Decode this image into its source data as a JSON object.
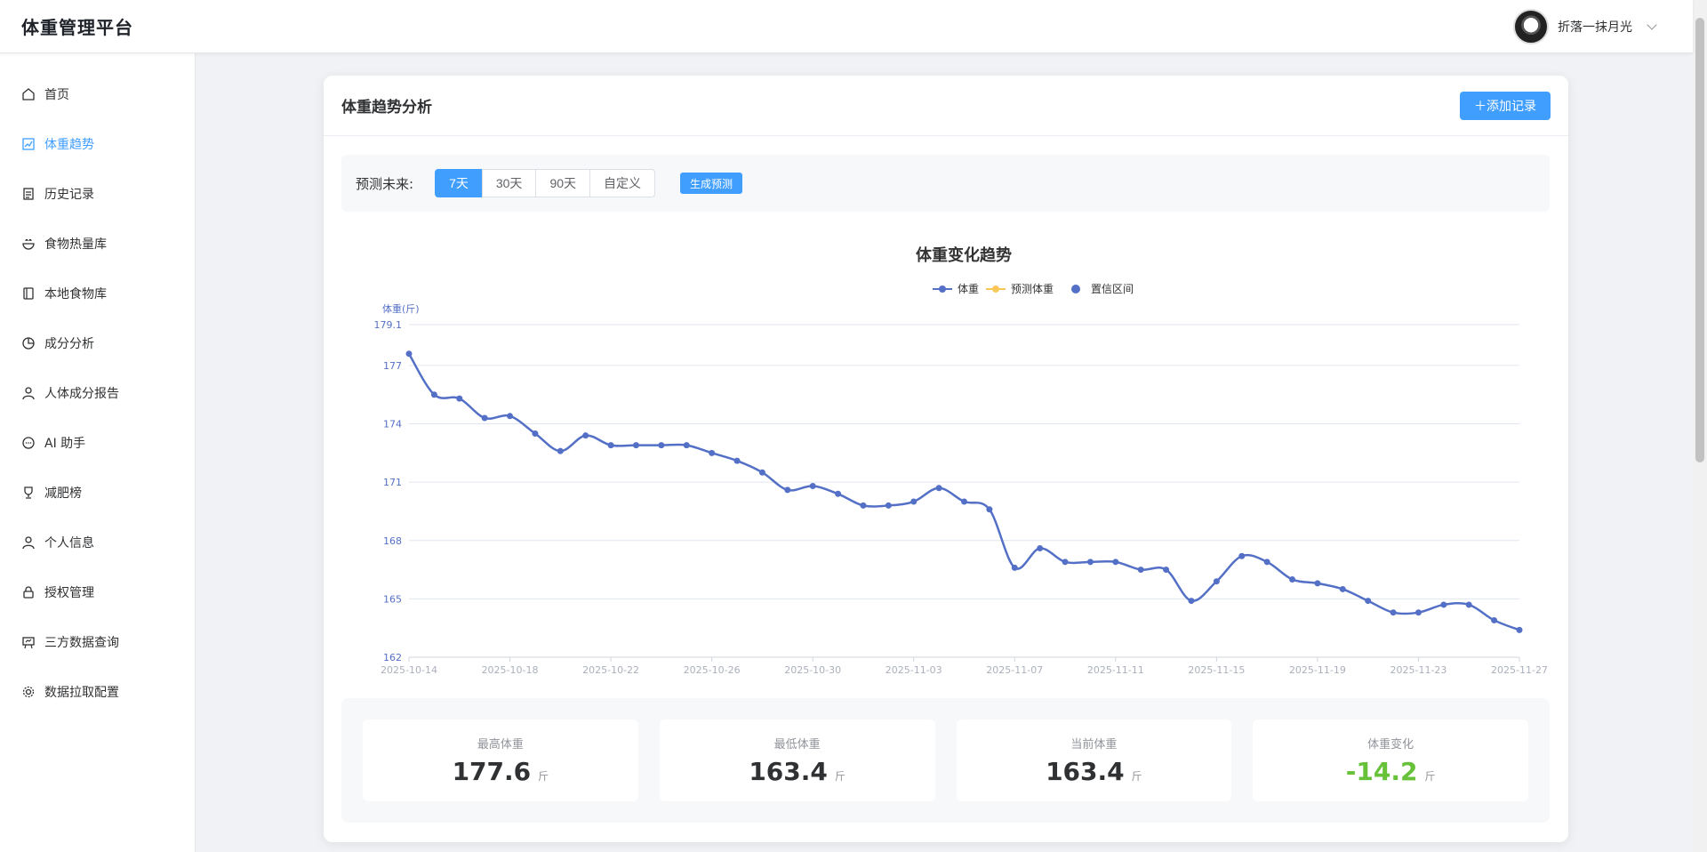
{
  "header": {
    "title": "体重管理平台",
    "username": "折落一抹月光"
  },
  "sidebar": {
    "items": [
      {
        "label": "首页",
        "icon": "home-icon"
      },
      {
        "label": "体重趋势",
        "icon": "chart-icon",
        "active": true
      },
      {
        "label": "历史记录",
        "icon": "history-icon"
      },
      {
        "label": "食物热量库",
        "icon": "bowl-icon"
      },
      {
        "label": "本地食物库",
        "icon": "book-icon"
      },
      {
        "label": "成分分析",
        "icon": "pie-icon"
      },
      {
        "label": "人体成分报告",
        "icon": "user-icon"
      },
      {
        "label": "AI 助手",
        "icon": "chat-icon"
      },
      {
        "label": "减肥榜",
        "icon": "trophy-icon"
      },
      {
        "label": "个人信息",
        "icon": "user-icon"
      },
      {
        "label": "授权管理",
        "icon": "lock-icon"
      },
      {
        "label": "三方数据查询",
        "icon": "board-icon"
      },
      {
        "label": "数据拉取配置",
        "icon": "gear-icon"
      }
    ]
  },
  "card": {
    "title": "体重趋势分析",
    "add_button": "＋添加记录",
    "predict_label": "预测未来:",
    "ranges": [
      "7天",
      "30天",
      "90天",
      "自定义"
    ],
    "active_range": "7天",
    "generate_button": "生成预测"
  },
  "stats": [
    {
      "label": "最高体重",
      "value": "177.6",
      "unit": "斤"
    },
    {
      "label": "最低体重",
      "value": "163.4",
      "unit": "斤"
    },
    {
      "label": "当前体重",
      "value": "163.4",
      "unit": "斤"
    },
    {
      "label": "体重变化",
      "value": "-14.2",
      "unit": "斤",
      "color": "#67c23a"
    }
  ],
  "chart_data": {
    "type": "line",
    "title": "体重变化趋势",
    "ylabel": "体重(斤)",
    "ylim": [
      162,
      179.1
    ],
    "yticks": [
      "179.1",
      "177",
      "174",
      "171",
      "168",
      "165",
      "162"
    ],
    "xticks": [
      "2025-10-14",
      "2025-10-18",
      "2025-10-22",
      "2025-10-26",
      "2025-10-30",
      "2025-11-03",
      "2025-11-07",
      "2025-11-11",
      "2025-11-15",
      "2025-11-19",
      "2025-11-23",
      "2025-11-27"
    ],
    "legend": [
      "体重",
      "预测体重",
      "置信区间"
    ],
    "legend_colors": [
      "#5470c6",
      "#fac858",
      "#5470c6"
    ],
    "grid": true,
    "series": [
      {
        "name": "体重",
        "color": "#5470c6",
        "x": [
          "2025-10-14",
          "2025-10-15",
          "2025-10-16",
          "2025-10-17",
          "2025-10-18",
          "2025-10-19",
          "2025-10-20",
          "2025-10-21",
          "2025-10-22",
          "2025-10-23",
          "2025-10-24",
          "2025-10-25",
          "2025-10-26",
          "2025-10-27",
          "2025-10-28",
          "2025-10-29",
          "2025-10-30",
          "2025-10-31",
          "2025-11-01",
          "2025-11-02",
          "2025-11-03",
          "2025-11-04",
          "2025-11-05",
          "2025-11-06",
          "2025-11-07",
          "2025-11-08",
          "2025-11-09",
          "2025-11-10",
          "2025-11-11",
          "2025-11-12",
          "2025-11-13",
          "2025-11-14",
          "2025-11-15",
          "2025-11-16",
          "2025-11-17",
          "2025-11-18",
          "2025-11-19",
          "2025-11-20",
          "2025-11-21",
          "2025-11-22",
          "2025-11-23",
          "2025-11-24",
          "2025-11-25",
          "2025-11-26",
          "2025-11-27"
        ],
        "values": [
          177.6,
          175.5,
          175.3,
          174.3,
          174.4,
          173.5,
          172.6,
          173.4,
          172.9,
          172.9,
          172.9,
          172.9,
          172.5,
          172.1,
          171.5,
          170.6,
          170.8,
          170.4,
          169.8,
          169.8,
          170.0,
          170.7,
          170.0,
          169.6,
          166.6,
          167.6,
          166.9,
          166.9,
          166.9,
          166.5,
          166.5,
          164.9,
          165.9,
          167.2,
          166.9,
          166.0,
          165.8,
          165.5,
          164.9,
          164.3,
          164.3,
          164.7,
          164.7,
          163.9,
          163.4
        ]
      }
    ]
  }
}
